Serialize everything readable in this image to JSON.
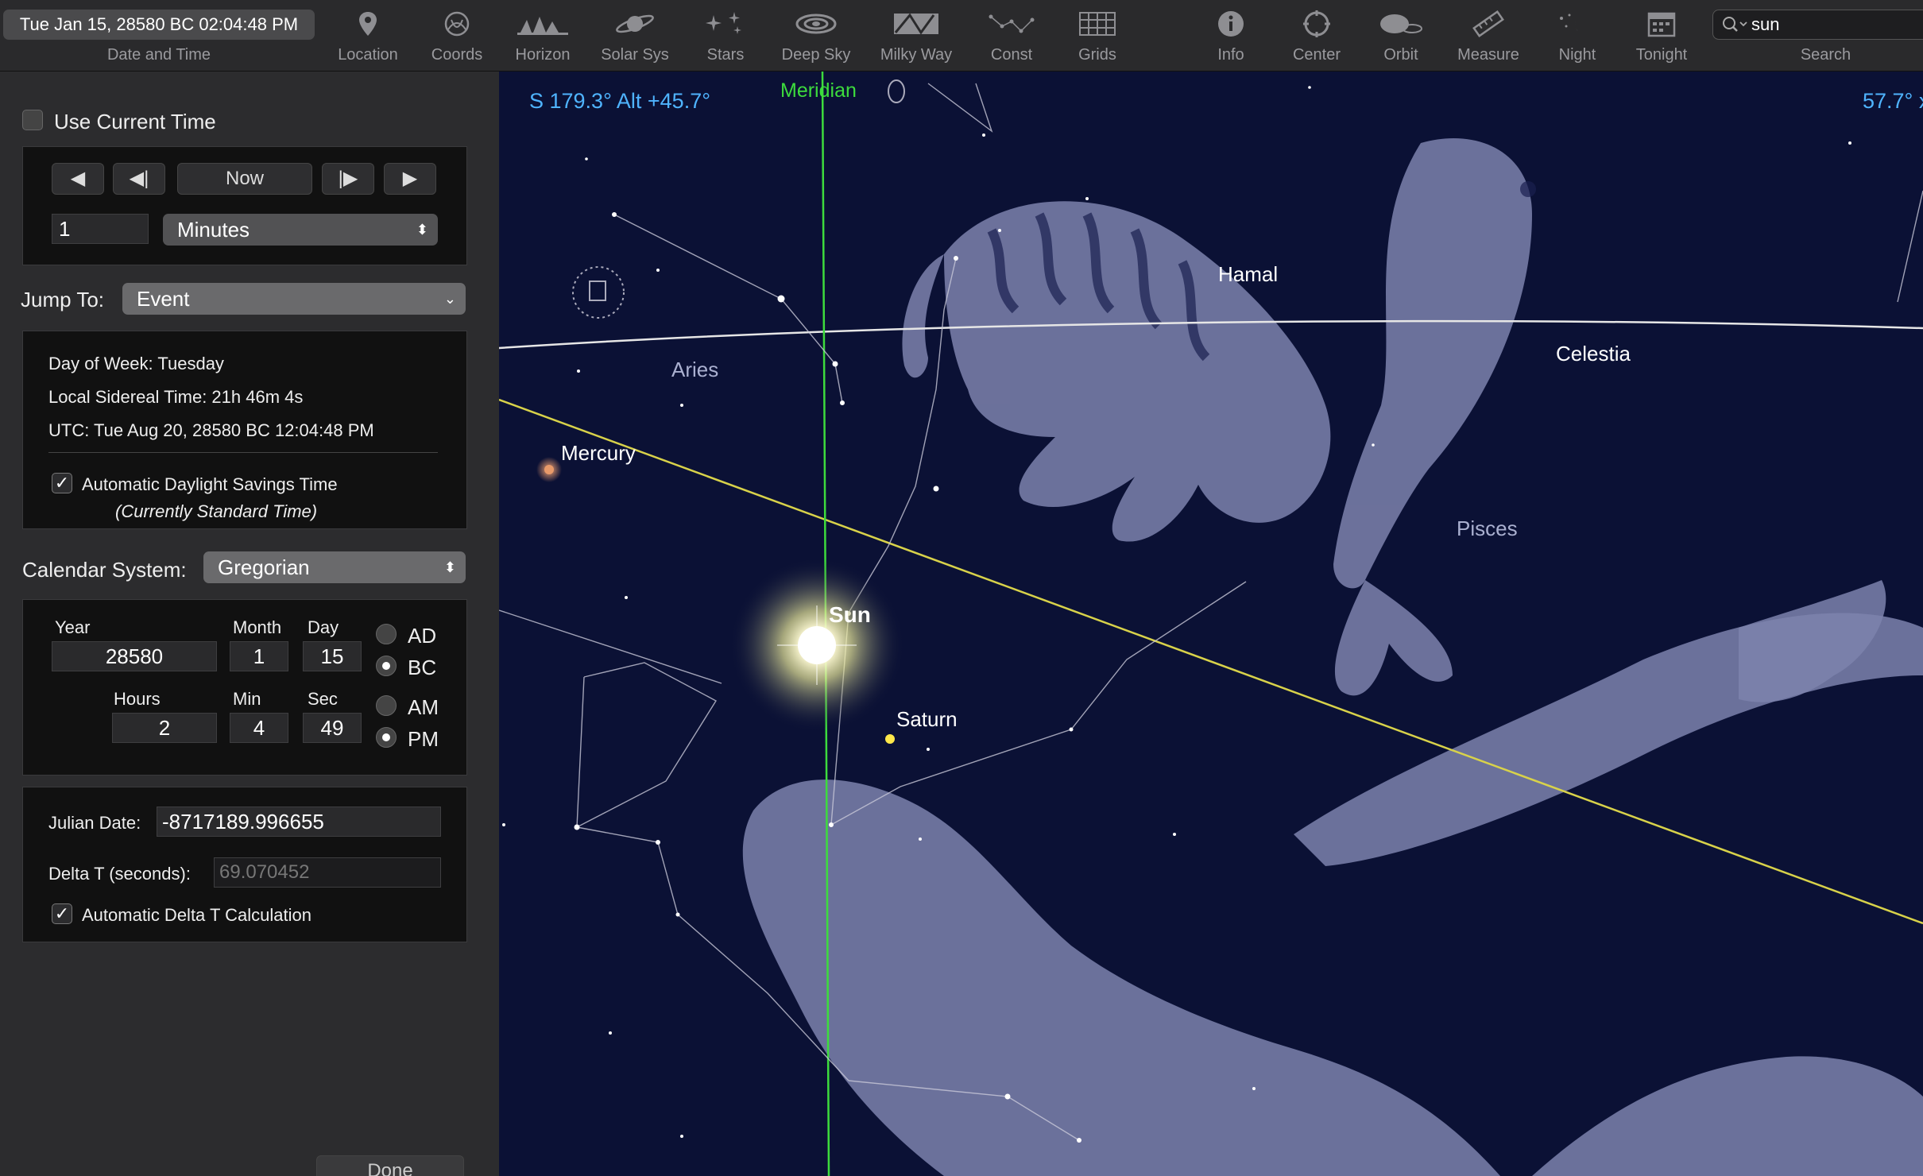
{
  "toolbar": {
    "datetime": "Tue Jan 15, 28580 BC 02:04:48 PM",
    "datetime_label": "Date and Time",
    "tools": [
      {
        "label": "Location",
        "icon": "location-pin-icon"
      },
      {
        "label": "Coords",
        "icon": "coords-icon"
      },
      {
        "label": "Horizon",
        "icon": "horizon-icon"
      },
      {
        "label": "Solar Sys",
        "icon": "planet-icon"
      },
      {
        "label": "Stars",
        "icon": "stars-icon"
      },
      {
        "label": "Deep Sky",
        "icon": "galaxy-icon"
      },
      {
        "label": "Milky Way",
        "icon": "milky-way-icon"
      },
      {
        "label": "Const",
        "icon": "constellation-icon"
      },
      {
        "label": "Grids",
        "icon": "grid-icon"
      },
      {
        "label": "Info",
        "icon": "info-icon"
      },
      {
        "label": "Center",
        "icon": "center-icon"
      },
      {
        "label": "Orbit",
        "icon": "orbit-icon"
      },
      {
        "label": "Measure",
        "icon": "ruler-icon"
      },
      {
        "label": "Night",
        "icon": "night-icon"
      },
      {
        "label": "Tonight",
        "icon": "calendar-icon"
      }
    ],
    "search": {
      "value": "sun",
      "label": "Search"
    }
  },
  "panel": {
    "use_current_time": "Use Current Time",
    "now_label": "Now",
    "step_value": "1",
    "step_unit": "Minutes",
    "jump_to_label": "Jump To:",
    "jump_to_value": "Event",
    "day_of_week": "Day of Week:  Tuesday",
    "sidereal": "Local Sidereal Time:  21h 46m 4s",
    "utc": "UTC:  Tue Aug 20, 28580 BC 12:04:48 PM",
    "auto_dst": "Automatic Daylight Savings Time",
    "dst_note": "(Currently Standard Time)",
    "calendar_label": "Calendar System:",
    "calendar_value": "Gregorian",
    "year_label": "Year",
    "year": "28580",
    "month_label": "Month",
    "month": "1",
    "day_label": "Day",
    "day": "15",
    "hours_label": "Hours",
    "hours": "2",
    "min_label": "Min",
    "min": "4",
    "sec_label": "Sec",
    "sec": "49",
    "ad": "AD",
    "bc": "BC",
    "am": "AM",
    "pm": "PM",
    "julian_label": "Julian Date:",
    "julian_value": "-8717189.996655",
    "deltat_label": "Delta T (seconds):",
    "deltat_value": "69.070452",
    "auto_deltat": "Automatic Delta T Calculation",
    "done": "Done"
  },
  "sky": {
    "readout": "S 179.3° Alt +45.7°",
    "fov": "57.7° x",
    "meridian": "Meridian",
    "labels": {
      "hamal": "Hamal",
      "aries": "Aries",
      "mercury": "Mercury",
      "sun": "Sun",
      "saturn": "Saturn",
      "pisces": "Pisces",
      "celestial": "Celestia"
    },
    "colors": {
      "background": "#0b1135",
      "ecliptic": "#d8d24a",
      "meridian": "#3ddc3d",
      "label": "#ffffff",
      "readout": "#4fb4ff"
    }
  }
}
